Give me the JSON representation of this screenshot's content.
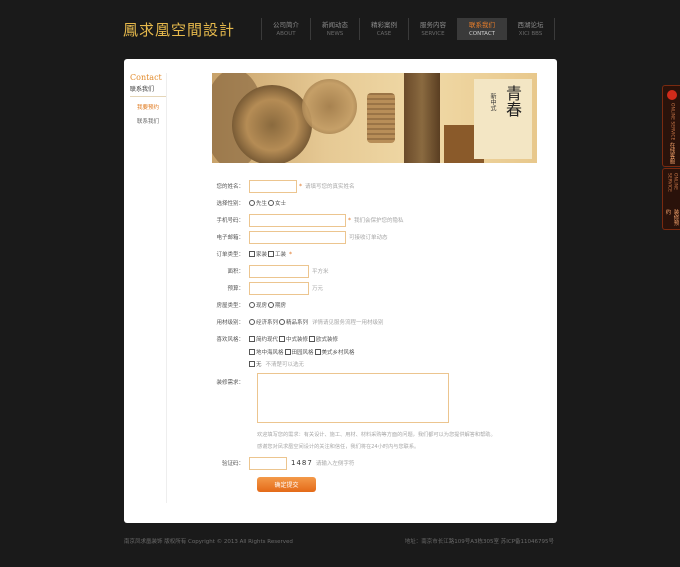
{
  "header": {
    "logo": "鳳求凰空間設計",
    "nav": [
      {
        "zh": "公司简介",
        "en": "ABOUT"
      },
      {
        "zh": "新闻动态",
        "en": "NEWS"
      },
      {
        "zh": "精彩案例",
        "en": "CASE"
      },
      {
        "zh": "服务内容",
        "en": "SERVICE"
      },
      {
        "zh": "联系我们",
        "en": "CONTACT"
      },
      {
        "zh": "西湖论坛",
        "en": "XICI BBS"
      }
    ]
  },
  "sidebar": {
    "title": "Contact",
    "subtitle": "联系我们",
    "items": [
      "我要预约",
      "联系我们"
    ]
  },
  "banner": {
    "calligraphy": "青春",
    "small_text": "新中式"
  },
  "form": {
    "name_label": "您的姓名：",
    "name_hint": "请填写您的真实姓名",
    "gender_label": "选择性别：",
    "gender_options": [
      "先生",
      "女士"
    ],
    "phone_label": "手机号码：",
    "phone_hint": "我们会保护您的隐私",
    "email_label": "电子邮箱：",
    "email_hint": "可接收订单动态",
    "order_type_label": "订单类型：",
    "order_type_options": [
      "家装",
      "工装"
    ],
    "area_label": "面积：",
    "area_unit": "平方米",
    "budget_label": "预算：",
    "budget_unit": "万元",
    "house_type_label": "房屋类型：",
    "house_type_options": [
      "现房",
      "期房"
    ],
    "material_label": "用材级别：",
    "material_options": [
      "经济系列",
      "精品系列"
    ],
    "material_note": "详情请见服务流程一用材级别",
    "style_label": "喜欢风格：",
    "style_row1": [
      "简约现代",
      "中式装修",
      "欧式装修"
    ],
    "style_row2": [
      "地中海风格",
      "田园风格",
      "美式乡村风格"
    ],
    "style_row3": [
      "无"
    ],
    "style_hint": "不清楚可以选无",
    "needs_label": "装修需求：",
    "note_line1": "欢迎填写您的需求：有关设计、施工、用材、材料采购等方面的问题，我们都可以为您提供解答和帮助。",
    "note_line2": "感谢您对凤求凰空间设计的关注和信任，我们将在24小时内与您联系。",
    "captcha_label": "验证码：",
    "captcha_code": "1487",
    "captcha_hint": "请输入左侧字符",
    "submit": "确定提交"
  },
  "footer": {
    "left": "南京凤求凰装饰 版权所有 Copyright © 2013 All Rights Reserved",
    "right": "地址：南京市长江路109号A3栋305室 苏ICP备11046795号"
  },
  "float_tabs": [
    {
      "en": "ONLINE SERVICE",
      "zh": "在线客服"
    },
    {
      "en": "ONLINE SERVICE",
      "zh": "装修预约"
    }
  ]
}
